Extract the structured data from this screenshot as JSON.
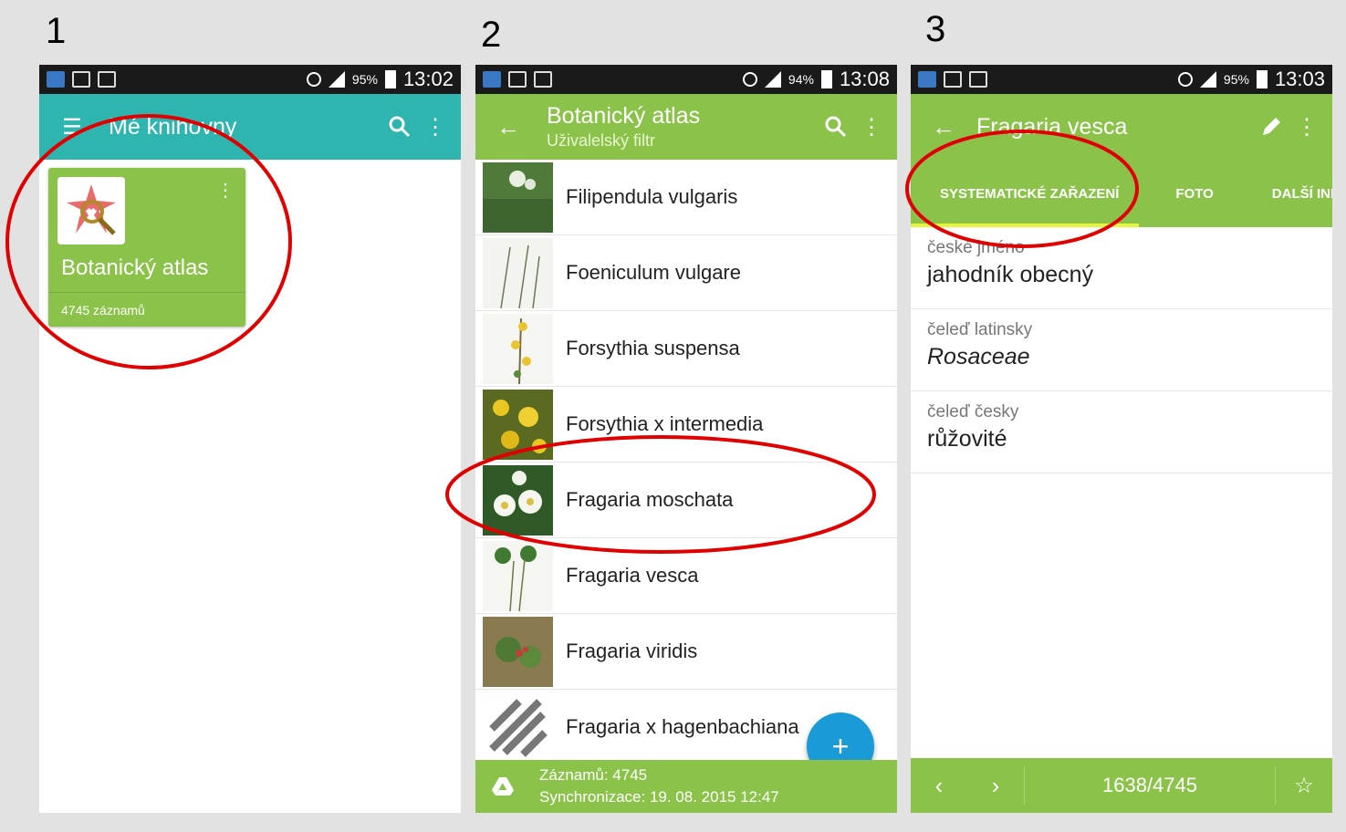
{
  "steps": [
    "1",
    "2",
    "3"
  ],
  "phone1": {
    "status": {
      "battery": "95%",
      "time": "13:02"
    },
    "title": "Mé knihovny",
    "library": {
      "name": "Botanický atlas",
      "count": "4745 záznamů"
    }
  },
  "phone2": {
    "status": {
      "battery": "94%",
      "time": "13:08"
    },
    "title": "Botanický atlas",
    "subtitle": "Uživalelský filtr",
    "items": [
      {
        "label": "Filipendula vulgaris"
      },
      {
        "label": "Foeniculum vulgare"
      },
      {
        "label": "Forsythia suspensa"
      },
      {
        "label": "Forsythia x intermedia"
      },
      {
        "label": "Fragaria moschata"
      },
      {
        "label": "Fragaria vesca"
      },
      {
        "label": "Fragaria viridis"
      },
      {
        "label": "Fragaria x hagenbachiana"
      }
    ],
    "fab": "+",
    "footer": {
      "records": "Záznamů: 4745",
      "sync": "Synchronizace: 19. 08. 2015 12:47"
    }
  },
  "phone3": {
    "status": {
      "battery": "95%",
      "time": "13:03"
    },
    "title": "Fragaria vesca",
    "tabs": [
      "SYSTEMATICKÉ ZAŘAZENÍ",
      "FOTO",
      "DALŠÍ INFO"
    ],
    "fields": [
      {
        "label": "české jméno",
        "value": "jahodník obecný"
      },
      {
        "label": "čeleď latinsky",
        "value": "Rosaceae"
      },
      {
        "label": "čeleď česky",
        "value": "růžovité"
      }
    ],
    "pager": "1638/4745"
  },
  "colors": {
    "green": "#8bc34a",
    "teal": "#2fb5b0",
    "fab": "#1a9bd7",
    "annotation": "#e00000"
  }
}
